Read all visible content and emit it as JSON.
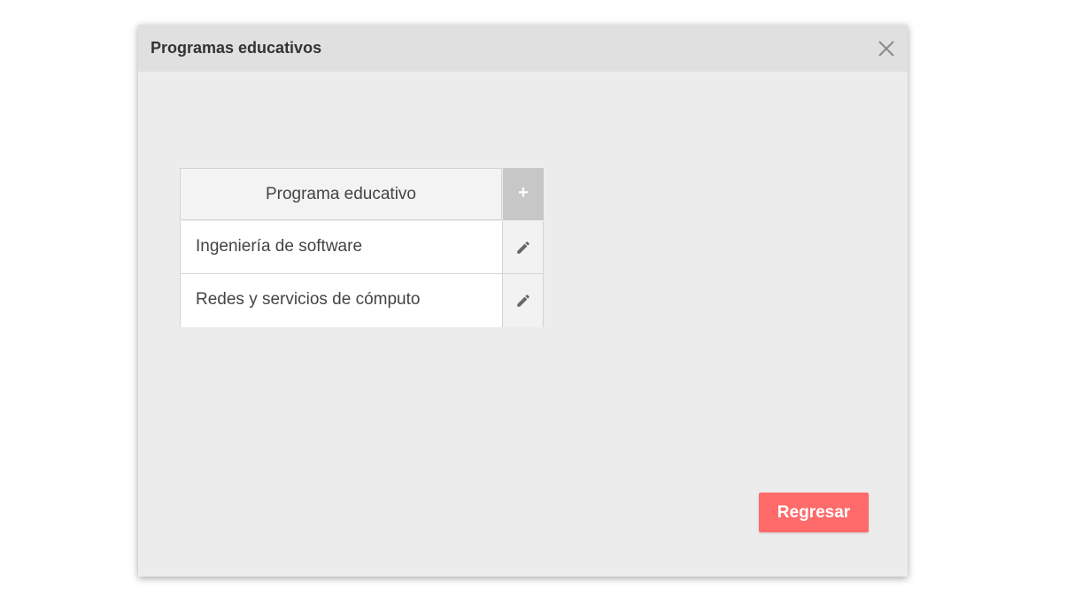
{
  "dialog": {
    "title": "Programas educativos",
    "close_icon": "close-icon"
  },
  "table": {
    "header": "Programa educativo",
    "add_label": "+",
    "rows": [
      {
        "label": "Ingeniería de software",
        "action_icon": "pencil-icon"
      },
      {
        "label": "Redes y servicios de cómputo",
        "action_icon": "pencil-icon"
      }
    ]
  },
  "footer": {
    "back_label": "Regresar"
  },
  "colors": {
    "accent": "#ff6a6a",
    "header_bg": "#e0e0e0",
    "body_bg": "#ececec"
  }
}
